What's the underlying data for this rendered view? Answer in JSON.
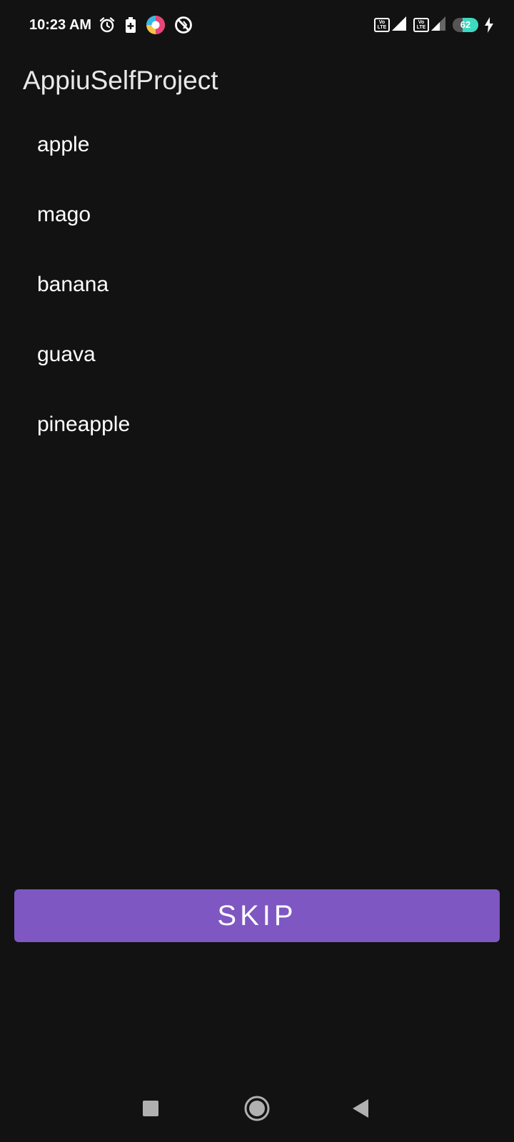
{
  "status_bar": {
    "time": "10:23 AM",
    "icons": [
      "alarm-icon",
      "battery-saver-icon",
      "app-notification-icon",
      "vpn-blocked-icon"
    ],
    "sim1": "Vo LTE",
    "sim2": "Vo LTE",
    "battery_level": "62",
    "battery_fraction": 0.62,
    "charging": true
  },
  "app_bar": {
    "title": "AppiuSelfProject"
  },
  "fruits": [
    {
      "label": "apple"
    },
    {
      "label": "mago"
    },
    {
      "label": "banana"
    },
    {
      "label": "guava"
    },
    {
      "label": "pineapple"
    }
  ],
  "skip_button": {
    "label": "SKIP"
  },
  "nav_bar": {
    "buttons": [
      "recents-icon",
      "home-icon",
      "back-icon"
    ]
  },
  "colors": {
    "background": "#121212",
    "accent": "#7e57c2",
    "battery": "#3dd9c1"
  }
}
